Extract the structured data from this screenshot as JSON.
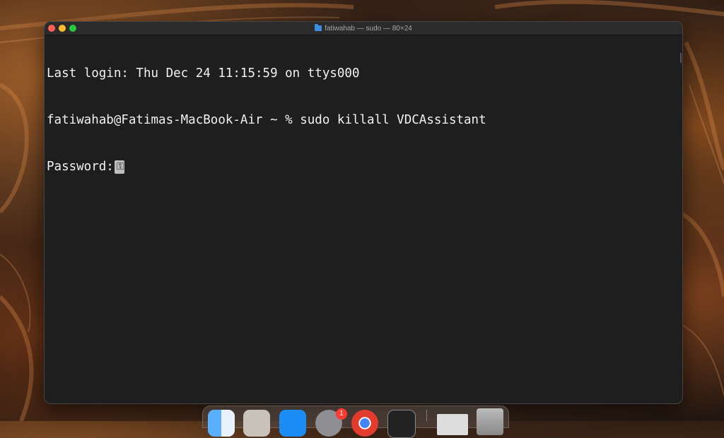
{
  "window": {
    "title": "fatiwahab — sudo — 80×24",
    "title_icon": "folder-icon"
  },
  "terminal": {
    "lines": [
      "Last login: Thu Dec 24 11:15:59 on ttys000",
      "fatiwahab@Fatimas-MacBook-Air ~ % sudo killall VDCAssistant",
      "Password:"
    ],
    "cursor_icon": "key-icon"
  },
  "dock": {
    "items": [
      {
        "name": "finder"
      },
      {
        "name": "launchpad"
      },
      {
        "name": "app-store"
      },
      {
        "name": "system-preferences",
        "badge": "1"
      },
      {
        "name": "chrome"
      },
      {
        "name": "terminal"
      },
      {
        "name": "preview"
      },
      {
        "name": "trash"
      }
    ]
  },
  "colors": {
    "terminal_bg": "#1e1e1e",
    "terminal_text": "#f2f2f2",
    "close": "#ff5f57",
    "minimize": "#febc2e",
    "maximize": "#28c840"
  }
}
